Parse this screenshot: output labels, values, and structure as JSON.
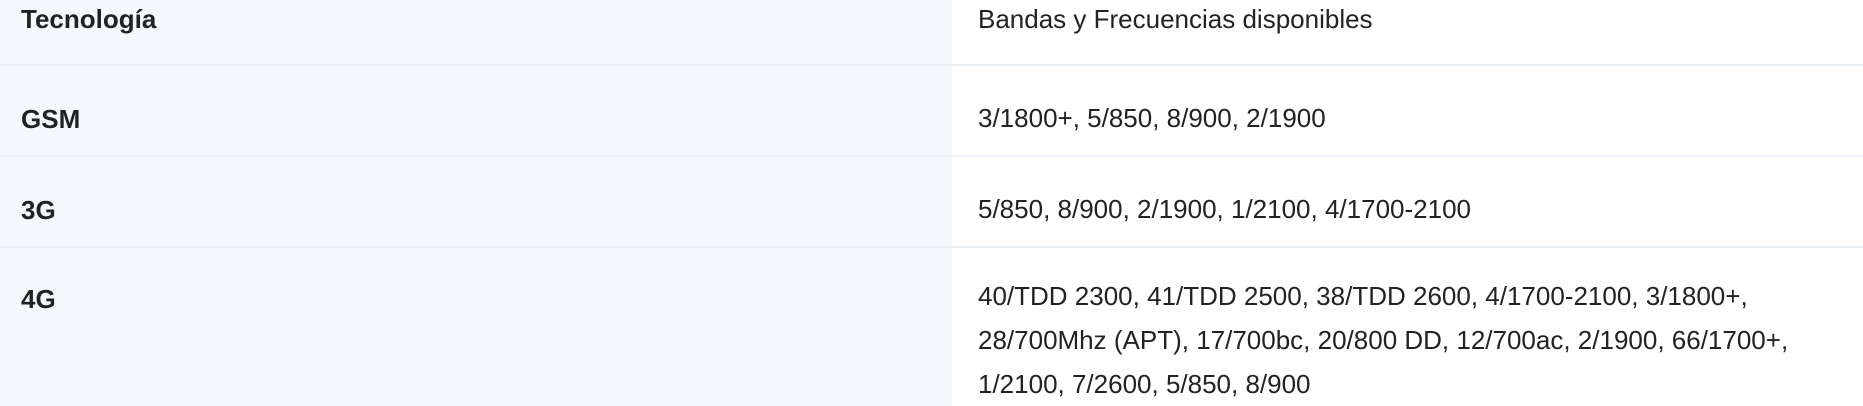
{
  "table": {
    "header": {
      "technology": "Tecnología",
      "frequencies": "Bandas y Frecuencias disponibles"
    },
    "rows": [
      {
        "technology": "GSM",
        "frequencies": "3/1800+, 5/850, 8/900, 2/1900"
      },
      {
        "technology": "3G",
        "frequencies": "5/850, 8/900, 2/1900, 1/2100, 4/1700-2100"
      },
      {
        "technology": "4G",
        "frequencies": "40/TDD 2300, 41/TDD 2500, 38/TDD 2600, 4/1700-2100, 3/1800+, 28/700Mhz (APT), 17/700bc, 20/800 DD, 12/700ac, 2/1900, 66/1700+, 1/2100, 7/2600, 5/850, 8/900"
      }
    ]
  },
  "colors": {
    "label_cell_bg": "#f3f8fc",
    "row_divider": "#e9eff4",
    "text": "#222222"
  }
}
